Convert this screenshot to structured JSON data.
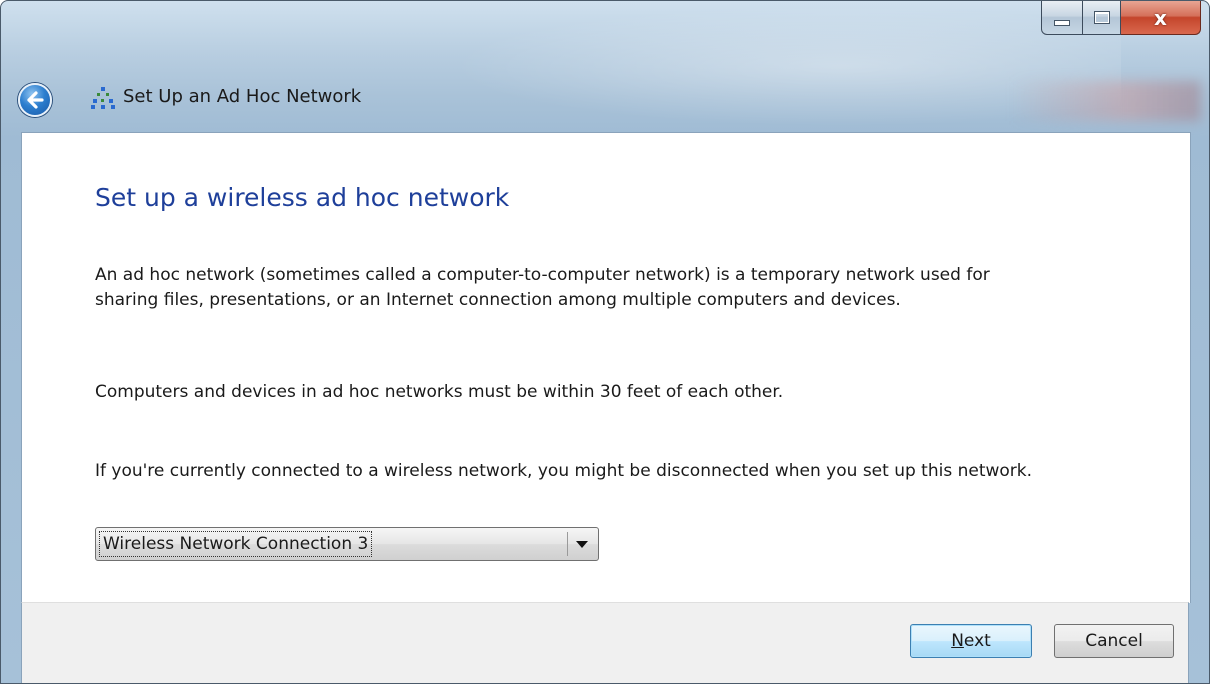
{
  "window": {
    "title": "Set Up an Ad Hoc Network",
    "caption": {
      "minimize_icon": "minimize-icon",
      "maximize_icon": "maximize-icon",
      "close_glyph": "x"
    }
  },
  "nav": {
    "back_icon": "back-arrow-icon",
    "app_icon": "ad-hoc-network-icon"
  },
  "page": {
    "heading": "Set up a wireless ad hoc network",
    "paragraph1": "An ad hoc network (sometimes called a computer-to-computer network) is a temporary network used for sharing files, presentations, or an Internet connection among multiple computers and devices.",
    "paragraph2": "Computers and devices in ad hoc networks must be within 30 feet of each other.",
    "paragraph3": "If you're currently connected to a wireless network, you might be disconnected when you set up this network.",
    "adapter_select": {
      "selected": "Wireless Network Connection 3"
    }
  },
  "footer": {
    "next_mnemonic": "N",
    "next_rest": "ext",
    "cancel_label": "Cancel"
  },
  "colors": {
    "heading": "#1e3f9a",
    "accent": "#3c7fb1"
  }
}
